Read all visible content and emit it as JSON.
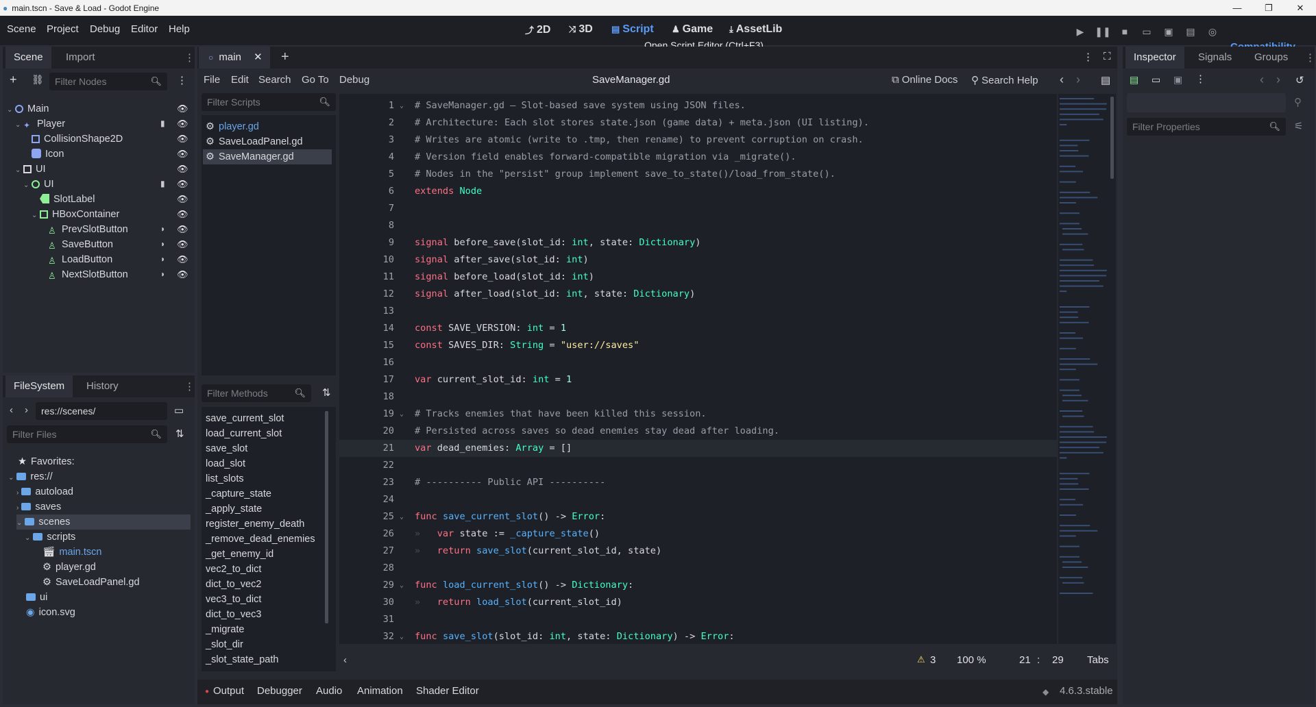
{
  "window": {
    "title": "main.tscn - Save & Load - Godot Engine"
  },
  "menu": {
    "scene": "Scene",
    "project": "Project",
    "debug": "Debug",
    "editor": "Editor",
    "help": "Help"
  },
  "workspaces": {
    "two_d": "2D",
    "three_d": "3D",
    "script": "Script",
    "game": "Game",
    "assetlib": "AssetLib"
  },
  "tooltip": "Open Script Editor (Ctrl+F3)",
  "renderer": "Compatibility",
  "scene_dock": {
    "tabs": [
      "Scene",
      "Import"
    ],
    "filter_placeholder": "Filter Nodes",
    "nodes": [
      "Main",
      "Player",
      "CollisionShape2D",
      "Icon",
      "UI",
      "UI",
      "SlotLabel",
      "HBoxContainer",
      "PrevSlotButton",
      "SaveButton",
      "LoadButton",
      "NextSlotButton"
    ]
  },
  "filesystem_dock": {
    "tabs": [
      "FileSystem",
      "History"
    ],
    "path": "res://scenes/",
    "filter_placeholder": "Filter Files",
    "items": [
      "Favorites:",
      "res://",
      "autoload",
      "saves",
      "scenes",
      "scripts",
      "main.tscn",
      "player.gd",
      "SaveLoadPanel.gd",
      "ui",
      "icon.svg"
    ]
  },
  "editor_tabs": {
    "main": "main"
  },
  "script_menu": {
    "file": "File",
    "edit": "Edit",
    "search": "Search",
    "goto": "Go To",
    "debug": "Debug"
  },
  "script_title": "SaveManager.gd",
  "script_links": {
    "online_docs": "Online Docs",
    "search_help": "Search Help"
  },
  "scripts": {
    "filter_placeholder": "Filter Scripts",
    "items": [
      "player.gd",
      "SaveLoadPanel.gd",
      "SaveManager.gd"
    ],
    "selected": "SaveManager.gd"
  },
  "methods": {
    "filter_placeholder": "Filter Methods",
    "items": [
      "save_current_slot",
      "load_current_slot",
      "save_slot",
      "load_slot",
      "list_slots",
      "_capture_state",
      "_apply_state",
      "register_enemy_death",
      "_remove_dead_enemies",
      "_get_enemy_id",
      "vec2_to_dict",
      "dict_to_vec2",
      "vec3_to_dict",
      "dict_to_vec3",
      "_migrate",
      "_slot_dir",
      "_slot_state_path"
    ]
  },
  "code": {
    "lines": [
      "# SaveManager.gd — Slot-based save system using JSON files.",
      "# Architecture: Each slot stores state.json (game data) + meta.json (UI listing).",
      "# Writes are atomic (write to .tmp, then rename) to prevent corruption on crash.",
      "# Version field enables forward-compatible migration via _migrate().",
      "# Nodes in the \"persist\" group implement save_to_state()/load_from_state().",
      "extends Node",
      "",
      "",
      "signal before_save(slot_id: int, state: Dictionary)",
      "signal after_save(slot_id: int)",
      "signal before_load(slot_id: int)",
      "signal after_load(slot_id: int, state: Dictionary)",
      "",
      "const SAVE_VERSION: int = 1",
      "const SAVES_DIR: String = \"user://saves\"",
      "",
      "var current_slot_id: int = 1",
      "",
      "# Tracks enemies that have been killed this session.",
      "# Persisted across saves so dead enemies stay dead after loading.",
      "var dead_enemies: Array = []",
      "",
      "# ---------- Public API ----------",
      "",
      "func save_current_slot() -> Error:",
      "    var state := _capture_state()",
      "    return save_slot(current_slot_id, state)",
      "",
      "func load_current_slot() -> Dictionary:",
      "    return load_slot(current_slot_id)",
      "",
      "func save_slot(slot_id: int, state: Dictionary) -> Error:"
    ],
    "current_line": 21
  },
  "status": {
    "warnings": "3",
    "zoom": "100 %",
    "line": "21",
    "col": "29",
    "indent": "Tabs"
  },
  "bottom_panel": {
    "tabs": [
      "Output",
      "Debugger",
      "Audio",
      "Animation",
      "Shader Editor"
    ],
    "version": "4.6.3.stable"
  },
  "inspector": {
    "tabs": [
      "Inspector",
      "Signals",
      "Groups"
    ],
    "filter_placeholder": "Filter Properties"
  }
}
